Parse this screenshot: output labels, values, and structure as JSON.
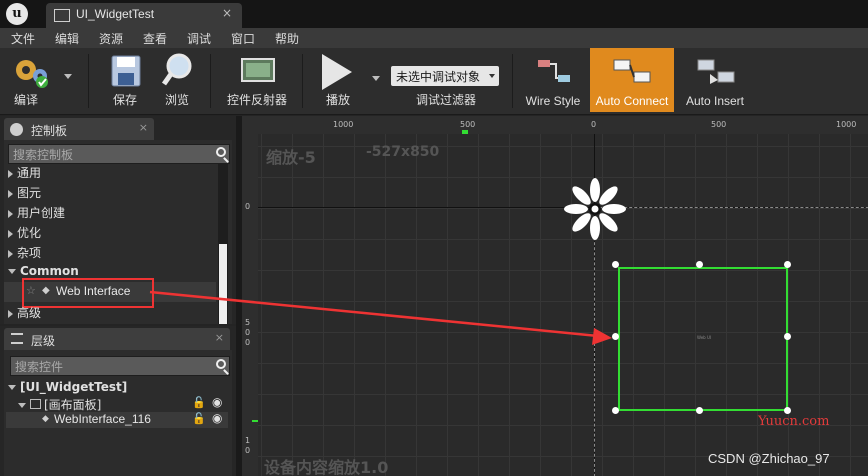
{
  "window": {
    "tab_title": "UI_WidgetTest",
    "tab_close": "×"
  },
  "menu": [
    "文件",
    "编辑",
    "资源",
    "查看",
    "调试",
    "窗口",
    "帮助"
  ],
  "toolbar": {
    "compile": "编译",
    "save": "保存",
    "browse": "浏览",
    "reflector": "控件反射器",
    "play": "播放",
    "debug_select": "未选中调试对象",
    "debug_filter": "调试过滤器",
    "wire_style": "Wire Style",
    "auto_connect": "Auto Connect",
    "auto_insert": "Auto Insert"
  },
  "palette": {
    "title": "控制板",
    "search_placeholder": "搜索控制板",
    "categories": [
      "通用",
      "图元",
      "用户创建",
      "优化",
      "杂项"
    ],
    "common_label": "Common",
    "selected_item": "Web Interface",
    "advanced": "高级"
  },
  "hierarchy": {
    "title": "层级",
    "search_placeholder": "搜索控件",
    "root": "[UI_WidgetTest]",
    "canvas_panel": "[画布面板]",
    "widget": "WebInterface_116"
  },
  "canvas": {
    "zoom_label": "缩放-5",
    "size_label": "-527x850",
    "device_scale": "设备内容缩放1.0",
    "ruler_top": [
      "1000",
      "500",
      "0",
      "500",
      "1000"
    ],
    "ruler_left": [
      "0",
      "5",
      "0",
      "0",
      "1",
      "0"
    ],
    "widget_inner_text": "Web UI",
    "accent_green": "#33dd33",
    "arrow_red": "#ee3333"
  },
  "watermarks": {
    "site": "Yuucn.com",
    "author": "CSDN @Zhichao_97"
  }
}
